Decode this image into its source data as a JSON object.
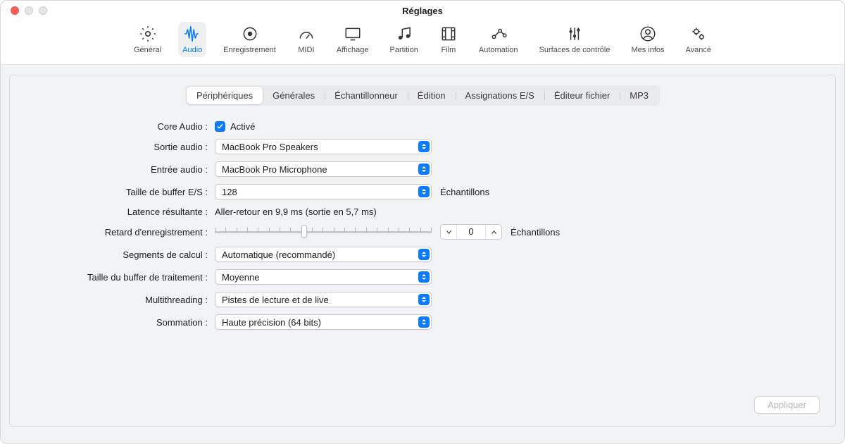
{
  "window": {
    "title": "Réglages"
  },
  "toolbar": {
    "items": [
      {
        "label": "Général"
      },
      {
        "label": "Audio"
      },
      {
        "label": "Enregistrement"
      },
      {
        "label": "MIDI"
      },
      {
        "label": "Affichage"
      },
      {
        "label": "Partition"
      },
      {
        "label": "Film"
      },
      {
        "label": "Automation"
      },
      {
        "label": "Surfaces de contrôle"
      },
      {
        "label": "Mes infos"
      },
      {
        "label": "Avancé"
      }
    ],
    "active_index": 1
  },
  "tabs": {
    "items": [
      "Périphériques",
      "Générales",
      "Échantillonneur",
      "Édition",
      "Assignations E/S",
      "Éditeur fichier",
      "MP3"
    ],
    "selected_index": 0
  },
  "labels": {
    "core_audio": "Core Audio :",
    "sortie_audio": "Sortie audio :",
    "entree_audio": "Entrée audio :",
    "buffer_es": "Taille de buffer E/S :",
    "latence": "Latence résultante :",
    "retard": "Retard d'enregistrement :",
    "segments": "Segments de calcul :",
    "buffer_traitement": "Taille du buffer de traitement :",
    "multithreading": "Multithreading :",
    "sommation": "Sommation :",
    "echantillons": "Échantillons",
    "active": "Activé"
  },
  "values": {
    "sortie_audio": "MacBook Pro Speakers",
    "entree_audio": "MacBook Pro Microphone",
    "buffer_es": "128",
    "latence": "Aller-retour en 9,9 ms (sortie en 5,7 ms)",
    "retard": "0",
    "segments": "Automatique (recommandé)",
    "buffer_traitement": "Moyenne",
    "multithreading": "Pistes de lecture et de live",
    "sommation": "Haute précision (64 bits)"
  },
  "buttons": {
    "apply": "Appliquer"
  },
  "colors": {
    "accent": "#0a7aff"
  }
}
